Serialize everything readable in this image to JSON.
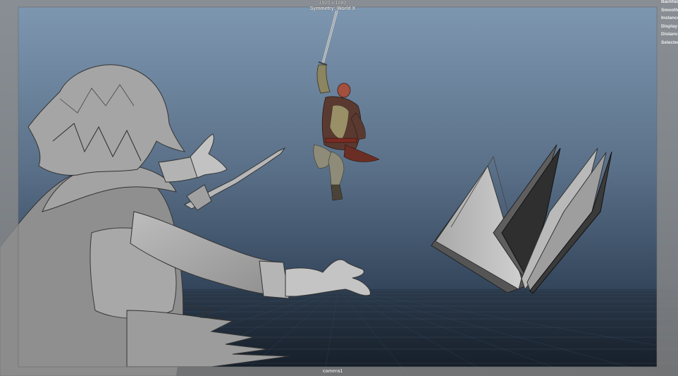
{
  "viewport": {
    "resolution_label": "1920 x 1080",
    "symmetry_label": "Symmetry: World X",
    "camera_label": "camera1",
    "hud_items": [
      "Backfac",
      "Smooth",
      "Instance",
      "Display",
      "Distance",
      "Selected"
    ]
  },
  "colors": {
    "sky_top": "#7f98b2",
    "sky_bottom": "#233243",
    "floor": "#1d2a38",
    "gate_mask": "#8c8c8c",
    "model_gray": "#9a9a9a"
  }
}
